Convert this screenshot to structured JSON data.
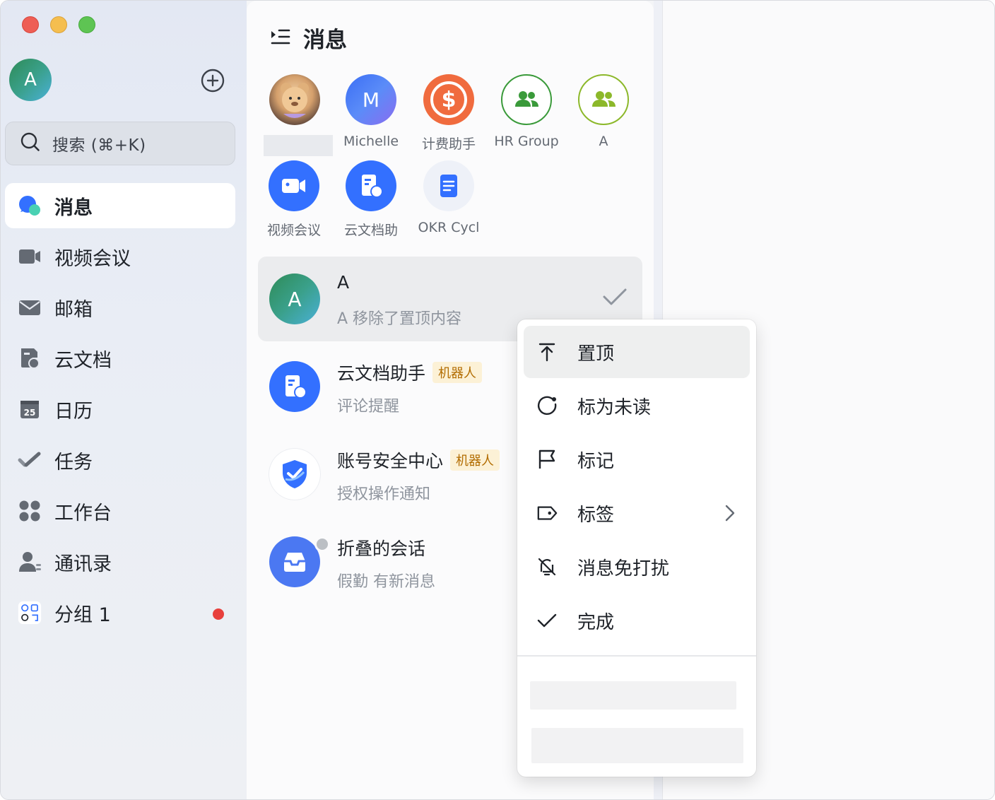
{
  "window": {
    "title": "消息"
  },
  "sidebar": {
    "me_avatar_letter": "A",
    "search_placeholder": "搜索 (⌘+K)",
    "items": [
      {
        "label": "消息",
        "icon": "chat-bubble-icon",
        "active": true
      },
      {
        "label": "视频会议",
        "icon": "video-camera-icon"
      },
      {
        "label": "邮箱",
        "icon": "mail-icon"
      },
      {
        "label": "云文档",
        "icon": "cloud-doc-icon"
      },
      {
        "label": "日历",
        "icon": "calendar-icon",
        "badge_text": "25"
      },
      {
        "label": "任务",
        "icon": "task-check-icon"
      },
      {
        "label": "工作台",
        "icon": "workbench-grid-icon"
      },
      {
        "label": "通讯录",
        "icon": "contacts-icon"
      },
      {
        "label": "分组 1",
        "icon": "group-apps-icon",
        "has_unread_dot": true
      }
    ]
  },
  "list": {
    "title": "消息",
    "pinned": [
      {
        "label": "",
        "avatar": "teddy-bear-photo"
      },
      {
        "label": "Michelle",
        "avatar_letter": "M"
      },
      {
        "label": "计费助手",
        "avatar": "dollar-coin-icon"
      },
      {
        "label": "HR Group",
        "avatar": "group-icon"
      },
      {
        "label": "A",
        "avatar": "group-icon"
      },
      {
        "label": "视频会议",
        "avatar": "video-camera-icon"
      },
      {
        "label": "云文档助",
        "avatar": "cloud-doc-icon"
      },
      {
        "label": "OKR Cycl",
        "avatar": "document-icon"
      }
    ],
    "conversations": [
      {
        "name": "A",
        "avatar_letter": "A",
        "preview": "A 移除了置顶内容",
        "done": true
      },
      {
        "name": "云文档助手",
        "badge": "机器人",
        "preview": "评论提醒"
      },
      {
        "name": "账号安全中心",
        "badge": "机器人",
        "preview": "授权操作通知"
      },
      {
        "name": "折叠的会话",
        "preview": "假勤 有新消息"
      }
    ]
  },
  "context_menu": {
    "items": [
      {
        "label": "置顶",
        "icon": "pin-top-icon"
      },
      {
        "label": "标为未读",
        "icon": "mark-unread-icon"
      },
      {
        "label": "标记",
        "icon": "flag-icon"
      },
      {
        "label": "标签",
        "icon": "tag-icon",
        "has_submenu": true
      },
      {
        "label": "消息免打扰",
        "icon": "bell-off-icon"
      },
      {
        "label": "完成",
        "icon": "check-icon"
      }
    ]
  },
  "colors": {
    "accent": "#3370ff",
    "badge_bg": "#fcf1d6",
    "badge_text": "#b26c00",
    "unread_dot": "#e8403c"
  }
}
